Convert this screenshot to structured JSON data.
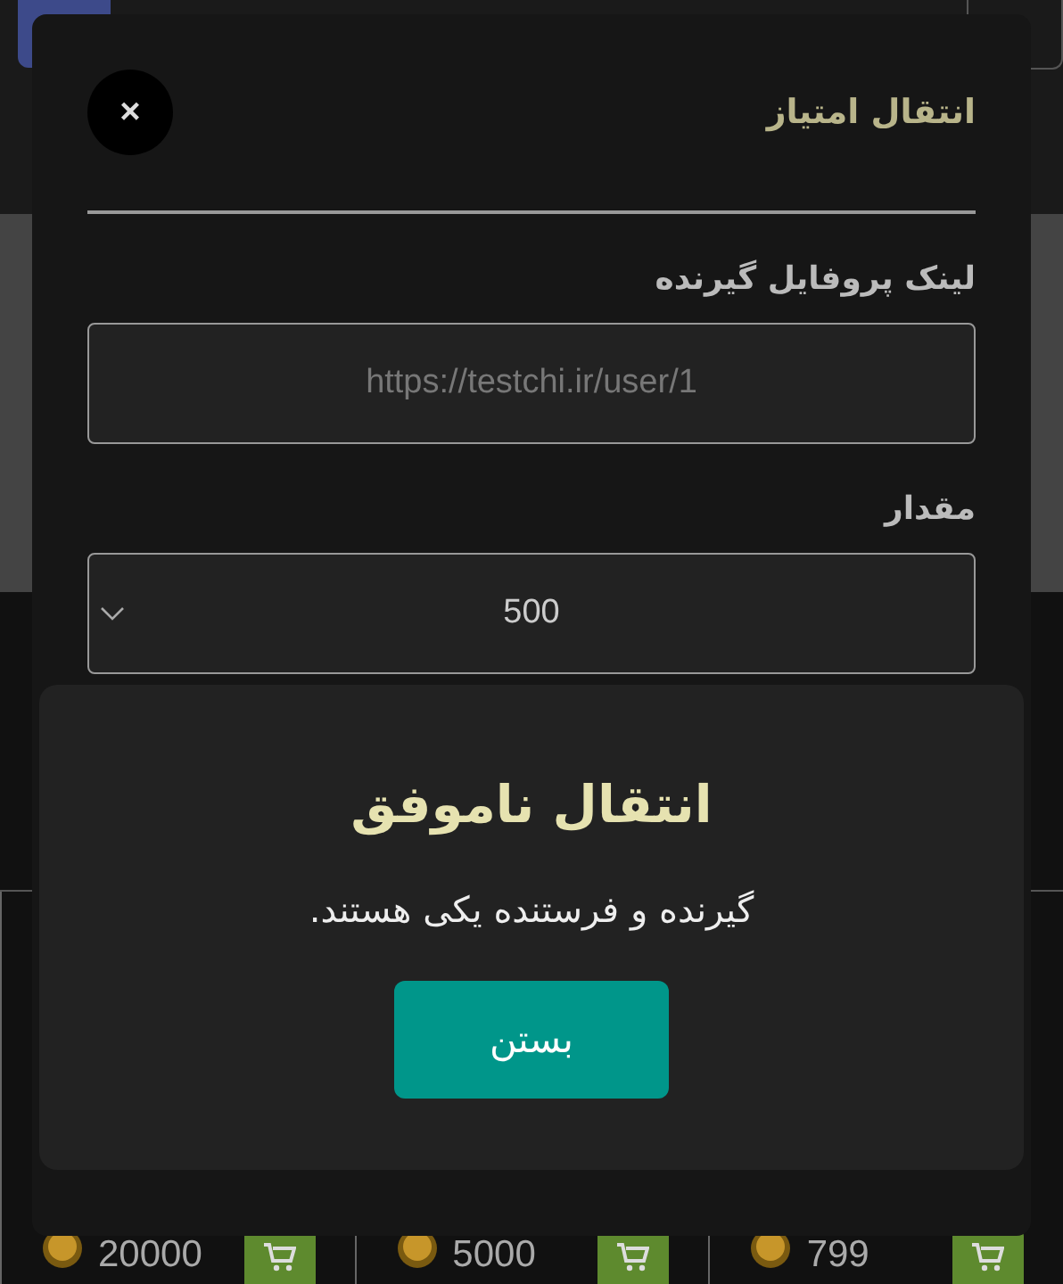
{
  "modal": {
    "title": "انتقال امتیاز",
    "close": "×",
    "fields": [
      {
        "kind": "text",
        "label": "لینک پروفایل گیرنده",
        "placeholder": "https://testchi.ir/user/1"
      },
      {
        "kind": "select",
        "label": "مقدار",
        "value": "500"
      }
    ]
  },
  "alert": {
    "title": "انتقال ناموفق",
    "message": "گیرنده و فرستنده یکی هستند.",
    "button": "بستن"
  },
  "products": [
    {
      "price": "799"
    },
    {
      "price": "5000"
    },
    {
      "price": "20000"
    }
  ]
}
